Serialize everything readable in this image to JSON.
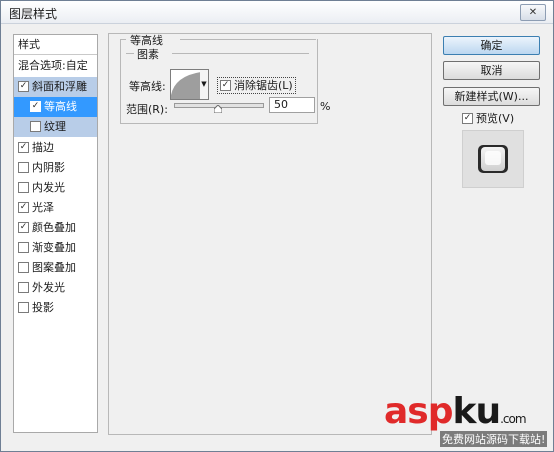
{
  "window": {
    "title": "图层样式",
    "close_glyph": "✕"
  },
  "style_list": {
    "header": "样式",
    "blend": "混合选项:自定",
    "items": [
      {
        "label": "斜面和浮雕",
        "checked": true
      },
      {
        "label": "等高线",
        "checked": true
      },
      {
        "label": "纹理",
        "checked": false
      },
      {
        "label": "描边",
        "checked": true
      },
      {
        "label": "内阴影",
        "checked": false
      },
      {
        "label": "内发光",
        "checked": false
      },
      {
        "label": "光泽",
        "checked": true
      },
      {
        "label": "颜色叠加",
        "checked": true
      },
      {
        "label": "渐变叠加",
        "checked": false
      },
      {
        "label": "图案叠加",
        "checked": false
      },
      {
        "label": "外发光",
        "checked": false
      },
      {
        "label": "投影",
        "checked": false
      }
    ]
  },
  "contour_panel": {
    "group_title": "等高线",
    "elements_title": "图素",
    "contour_label": "等高线:",
    "antialias_label": "消除锯齿(L)",
    "antialias_checked": true,
    "range_label": "范围(R):",
    "range_value": "50",
    "range_percent": 50,
    "range_unit": "%"
  },
  "buttons": {
    "ok": "确定",
    "cancel": "取消",
    "new_style": "新建样式(W)..."
  },
  "preview": {
    "label": "预览(V)",
    "checked": true
  },
  "watermark": {
    "brand_red": "asp",
    "brand_dark": "ku",
    "brand_suffix": ".com",
    "tagline": "免费网站源码下载站!"
  },
  "colors": {
    "selection": "#3399ff",
    "active_group": "#b8cde8",
    "ok_border": "#3c7fb1"
  }
}
